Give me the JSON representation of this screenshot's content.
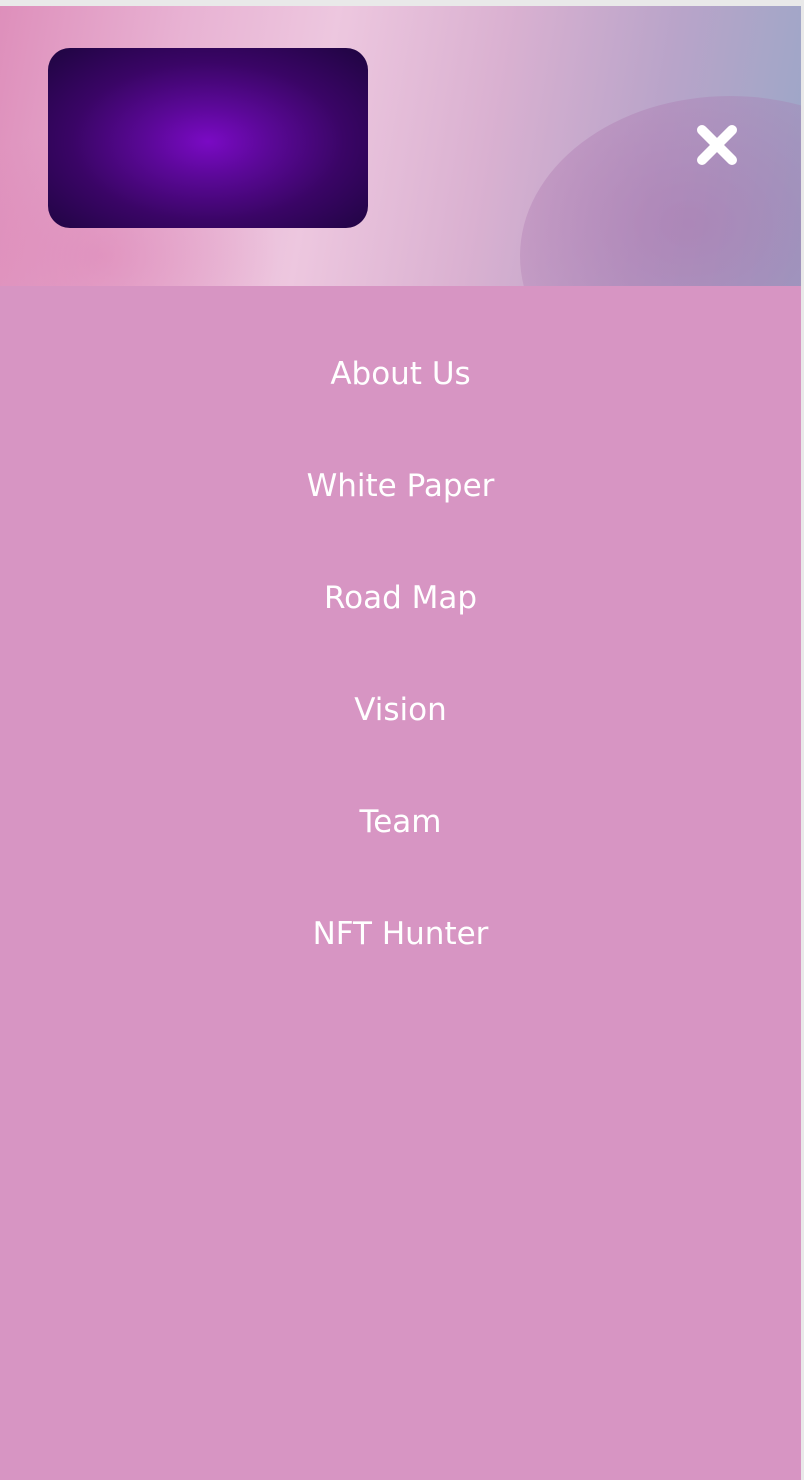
{
  "header": {
    "logo_icon": "brand-logo",
    "close_icon": "close-icon",
    "colors": {
      "logo_center": "#7a0ac4",
      "logo_edge": "#1e0540",
      "menu_background": "#d795c3",
      "text": "#ffffff"
    }
  },
  "menu": {
    "items": [
      {
        "label": "About Us"
      },
      {
        "label": "White Paper"
      },
      {
        "label": "Road Map"
      },
      {
        "label": "Vision"
      },
      {
        "label": "Team"
      },
      {
        "label": "NFT Hunter"
      }
    ]
  }
}
